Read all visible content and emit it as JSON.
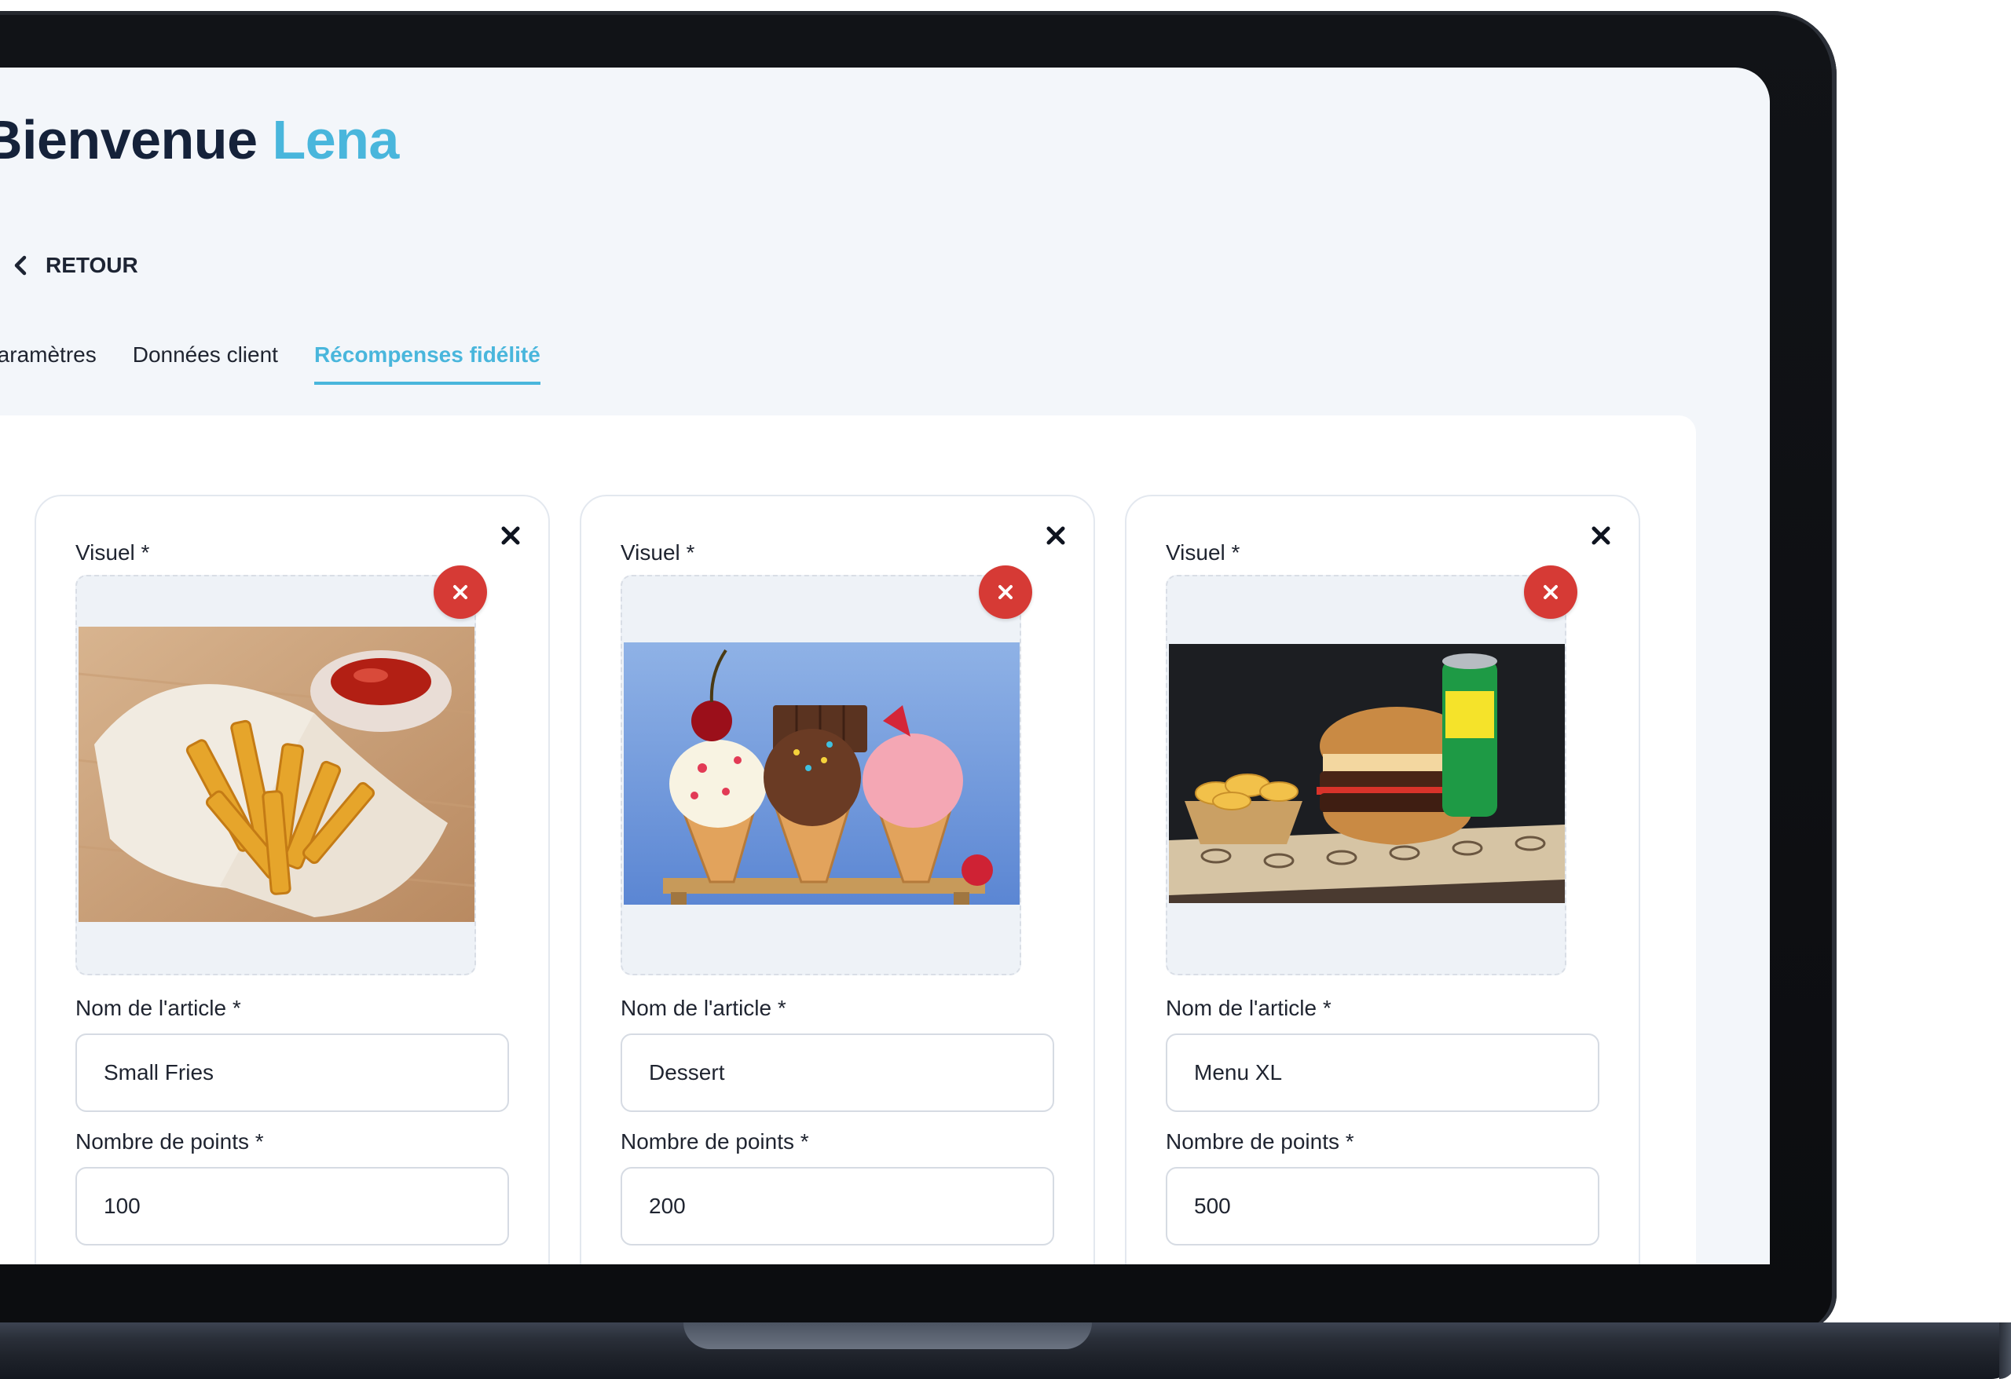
{
  "header": {
    "greeting": "Bienvenue",
    "user_name": "Lena"
  },
  "nav": {
    "back_label": "RETOUR"
  },
  "tabs": [
    {
      "label": "Paramètres",
      "active": false
    },
    {
      "label": "Données client",
      "active": false
    },
    {
      "label": "Récompenses fidélité",
      "active": true
    }
  ],
  "rewards": [
    {
      "visual_label": "Visuel *",
      "image": "french-fries-photo",
      "name_label": "Nom de l'article *",
      "name_value": "Small Fries",
      "points_label": "Nombre de points *",
      "points_value": "100"
    },
    {
      "visual_label": "Visuel *",
      "image": "ice-cream-cones-photo",
      "name_label": "Nom de l'article *",
      "name_value": "Dessert",
      "points_label": "Nombre de points *",
      "points_value": "200"
    },
    {
      "visual_label": "Visuel *",
      "image": "burger-menu-photo",
      "name_label": "Nom de l'article *",
      "name_value": "Menu XL",
      "points_label": "Nombre de points *",
      "points_value": "500"
    }
  ],
  "colors": {
    "accent": "#49b6dc",
    "title": "#15223a",
    "remove_button": "#d63a35",
    "page_background": "#f3f6fa"
  }
}
